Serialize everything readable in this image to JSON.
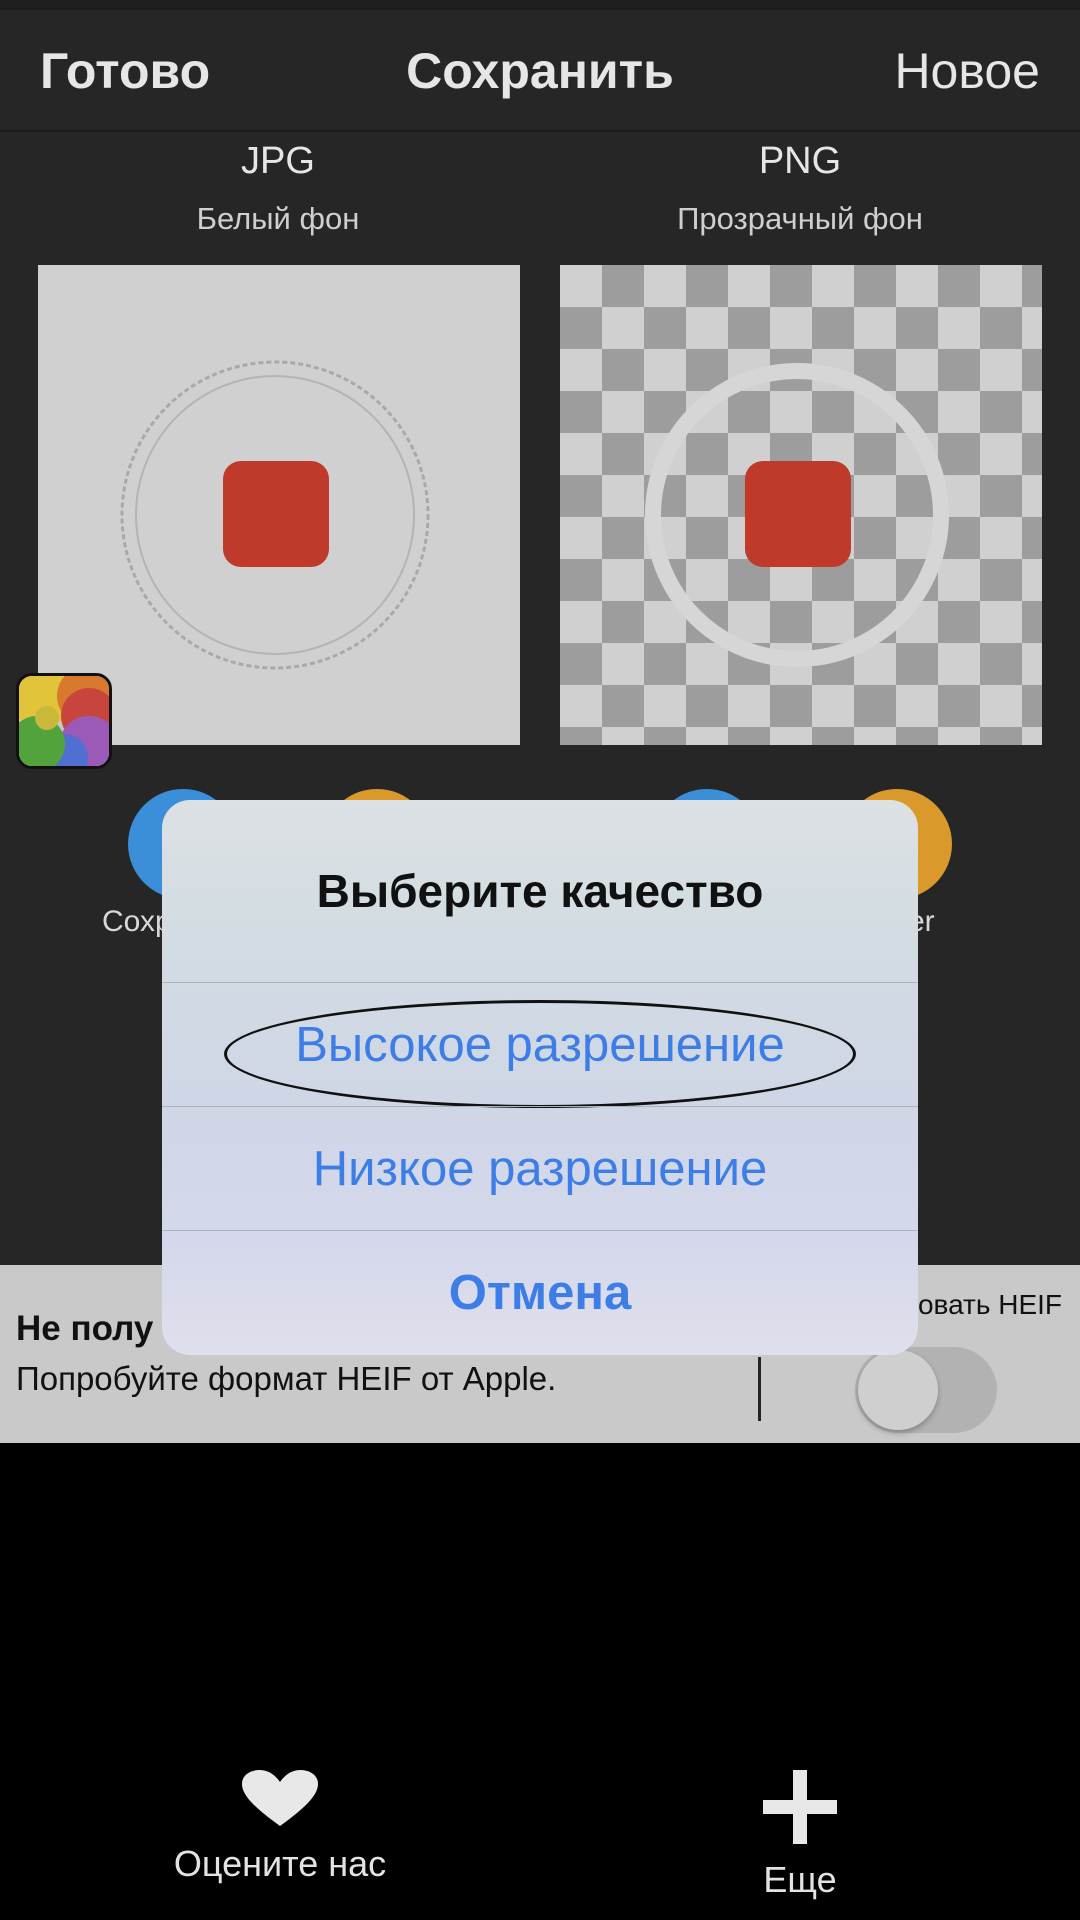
{
  "navbar": {
    "done_label": "Готово",
    "title": "Сохранить",
    "new_label": "Новое"
  },
  "formats": [
    {
      "name": "JPG",
      "subtitle": "Белый фон"
    },
    {
      "name": "PNG",
      "subtitle": "Прозрачный фон"
    }
  ],
  "share": {
    "left_label_visible": "Сохр",
    "right_label_visible": "er"
  },
  "heif_banner": {
    "title_visible": "Не полу",
    "subtitle": "Попробуйте формат HEIF от Apple.",
    "toggle_label_visible": "овать HEIF",
    "toggle_on": false
  },
  "tabs": {
    "rate_label": "Оцените нас",
    "more_label": "Еще"
  },
  "alert": {
    "title": "Выберите качество",
    "buttons": [
      "Высокое разрешение",
      "Низкое разрешение",
      "Отмена"
    ]
  },
  "colors": {
    "accent_blue": "#3d7ee6",
    "icon_red": "#c03a2b",
    "share_blue": "#3a8fd8",
    "share_orange": "#d99a2b"
  }
}
